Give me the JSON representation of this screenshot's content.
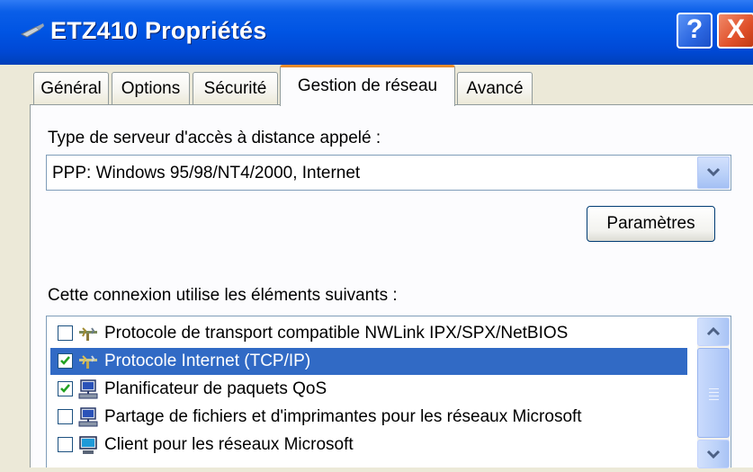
{
  "window": {
    "title": "ETZ410 Propriétés",
    "help_label": "?",
    "close_label": "X"
  },
  "tabs": [
    {
      "label": "Général"
    },
    {
      "label": "Options"
    },
    {
      "label": "Sécurité"
    },
    {
      "label": "Gestion de réseau",
      "active": true
    },
    {
      "label": "Avancé"
    }
  ],
  "server_type": {
    "label": "Type de serveur d'accès à distance appelé :",
    "selected": "PPP: Windows 95/98/NT4/2000, Internet"
  },
  "settings_button": {
    "label": "Paramètres"
  },
  "components": {
    "label": "Cette connexion utilise les éléments suivants :",
    "items": [
      {
        "label": "Protocole de transport compatible NWLink IPX/SPX/NetBIOS",
        "checked": false,
        "selected": false,
        "icon": "protocol-icon"
      },
      {
        "label": "Protocole Internet (TCP/IP)",
        "checked": true,
        "selected": true,
        "icon": "protocol-icon"
      },
      {
        "label": "Planificateur de paquets QoS",
        "checked": true,
        "selected": false,
        "icon": "network-service-icon"
      },
      {
        "label": "Partage de fichiers et d'imprimantes pour les réseaux Microsoft",
        "checked": false,
        "selected": false,
        "icon": "network-service-icon"
      },
      {
        "label": "Client pour les réseaux Microsoft",
        "checked": false,
        "selected": false,
        "icon": "network-client-icon"
      }
    ]
  },
  "colors": {
    "titlebar": "#0054e3",
    "selection": "#316ac5",
    "active_tab_accent": "#e68b2c"
  }
}
